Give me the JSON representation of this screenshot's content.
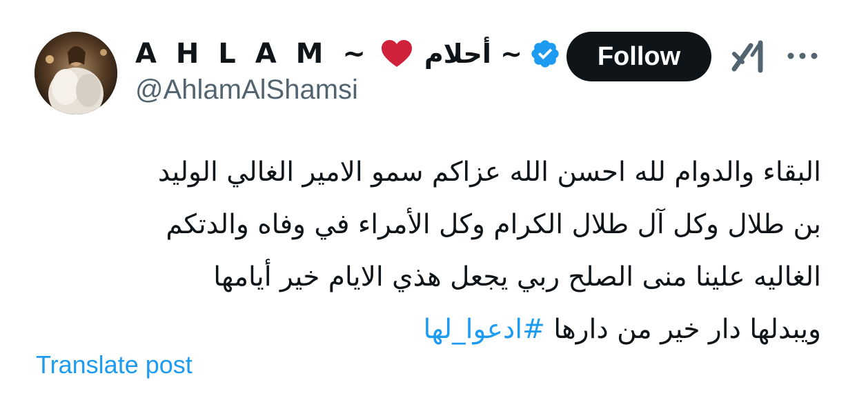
{
  "author": {
    "display_name_latin": "A H L A M ~",
    "display_name_arabic": "~ أحلام",
    "handle": "@AhlamAlShamsi",
    "verified": true,
    "verified_color": "#1d9bf0",
    "heart_color": "#d0213b"
  },
  "actions": {
    "follow_label": "Follow",
    "grok_icon": "grok-icon",
    "more_icon": "more-options-icon"
  },
  "post": {
    "lines": [
      "البقاء والدوام لله احسن الله عزاكم سمو الامير الغالي الوليد",
      "بن طلال وكل آل طلال الكرام وكل الأمراء في وفاه والدتكم",
      "الغاليه علينا منى الصلح ربي يجعل هذي الايام خير أيامها"
    ],
    "last_line_text": "ويبدلها دار خير من دارها",
    "hashtag": "#ادعوا_لها",
    "link_color": "#1d9bf0"
  },
  "translate_label": "Translate post"
}
